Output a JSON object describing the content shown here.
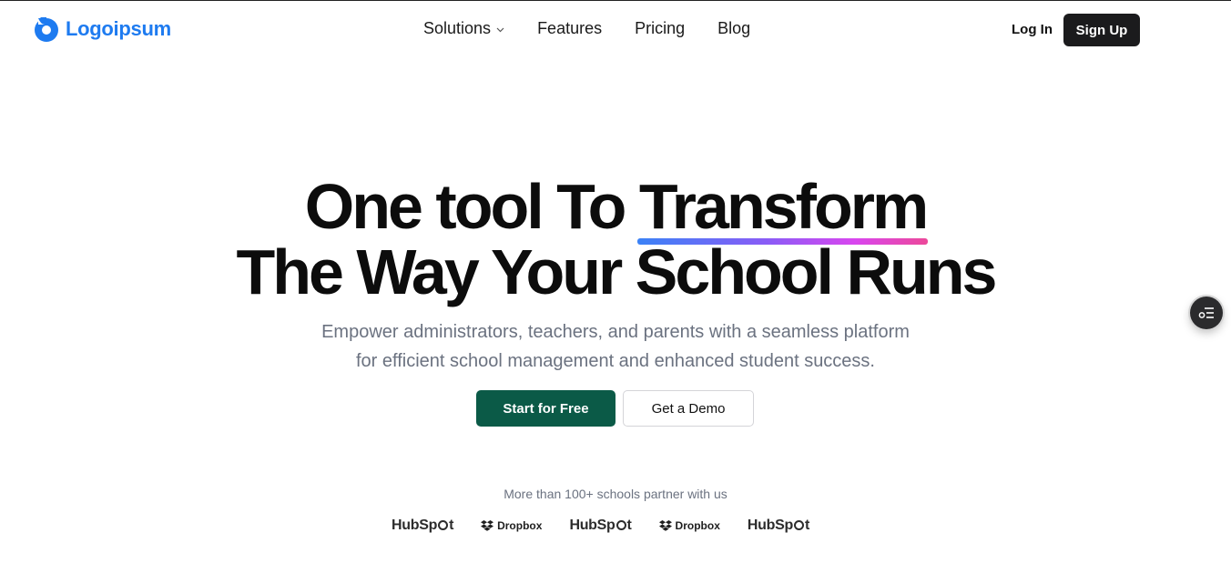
{
  "brand": {
    "name": "Logoipsum",
    "color": "#1e7bf0"
  },
  "nav": {
    "items": [
      {
        "label": "Solutions",
        "has_dropdown": true
      },
      {
        "label": "Features"
      },
      {
        "label": "Pricing"
      },
      {
        "label": "Blog"
      }
    ]
  },
  "auth": {
    "login_label": "Log In",
    "signup_label": "Sign Up"
  },
  "hero": {
    "title_line1_prefix": "One tool To ",
    "title_line1_highlight": "Transform",
    "title_line2": "The Way Your School Runs",
    "subtitle_line1": "Empower administrators, teachers, and parents with a seamless platform",
    "subtitle_line2": "for efficient school management and enhanced student success.",
    "primary_cta": "Start for Free",
    "secondary_cta": "Get a Demo",
    "primary_color": "#0b5a47",
    "highlight_gradient": [
      "#3b82f6",
      "#8b5cf6",
      "#d946ef",
      "#ec4899"
    ]
  },
  "partners": {
    "caption": "More than 100+ schools partner with us",
    "logos": [
      {
        "name": "HubSpot",
        "text_a": "HubSp",
        "text_b": "t",
        "icon": "hubspot-logo"
      },
      {
        "name": "Dropbox",
        "text": "Dropbox",
        "icon": "dropbox-logo"
      },
      {
        "name": "HubSpot",
        "text_a": "HubSp",
        "text_b": "t",
        "icon": "hubspot-logo"
      },
      {
        "name": "Dropbox",
        "text": "Dropbox",
        "icon": "dropbox-logo"
      },
      {
        "name": "HubSpot",
        "text_a": "HubSp",
        "text_b": "t",
        "icon": "hubspot-logo"
      }
    ]
  },
  "floating_button": {
    "icon": "list-settings-icon"
  }
}
